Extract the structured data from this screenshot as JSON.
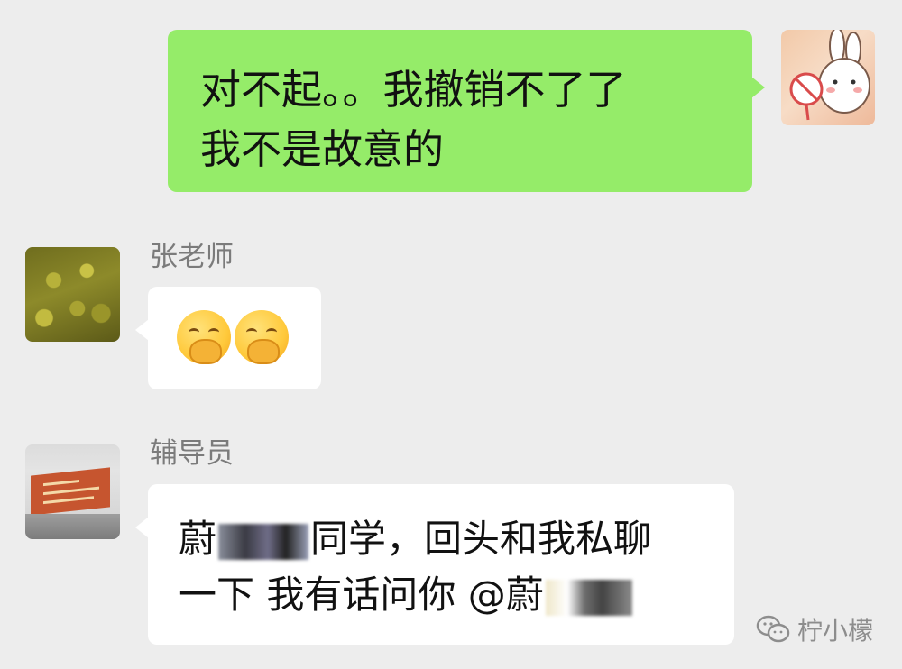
{
  "messages": [
    {
      "direction": "outgoing",
      "text": "对不起。。我撤销不了了\n我不是故意的",
      "bubble_color": "#95ec69"
    },
    {
      "direction": "incoming",
      "sender": "张老师",
      "content_type": "emoji",
      "emoji_count": 2,
      "emoji_icon": "face-with-hand-over-mouth-icon"
    },
    {
      "direction": "incoming",
      "sender": "辅导员",
      "text_part1": "蔚",
      "text_part2": "同学，回头和我私聊",
      "text_line2": "一下 我有话问你 @蔚"
    }
  ],
  "watermark": {
    "text": "柠小檬",
    "icon": "wechat-icon"
  },
  "colors": {
    "background": "#ededed",
    "outgoing_bubble": "#95ec69",
    "incoming_bubble": "#ffffff",
    "sender_name": "#7b7b7b"
  }
}
